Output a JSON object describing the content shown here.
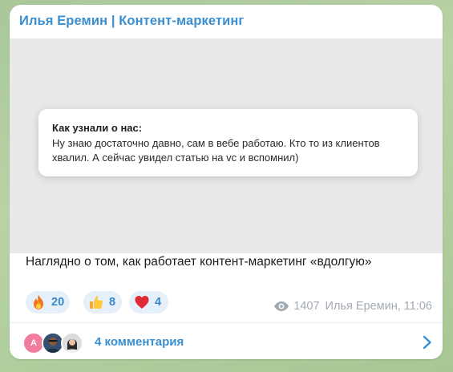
{
  "message": {
    "channel_name": "Илья Еремин | Контент-маркетинг",
    "screenshot_card": {
      "title": "Как узнали о нас:",
      "text": "Ну знаю достаточно давно, сам в вебе работаю. Кто то из клиентов хвалил. А сейчас увидел статью на vc и вспомнил)"
    },
    "caption": "Наглядно о том, как работает контент-маркетинг «вдолгую»",
    "reactions": [
      {
        "icon": "fire-icon",
        "count": "20"
      },
      {
        "icon": "thumbs-up-icon",
        "count": "8"
      },
      {
        "icon": "heart-icon",
        "count": "4"
      }
    ],
    "views": "1407",
    "author": "Илья Еремин,",
    "time": "11:06"
  },
  "comments": {
    "avatar_letter": "А",
    "label": "4 комментария"
  },
  "colors": {
    "accent": "#3a8fd1",
    "reaction_bg": "#e6f0fa",
    "meta_gray": "#a3aab2",
    "chat_bg": "#b8d3a4"
  }
}
